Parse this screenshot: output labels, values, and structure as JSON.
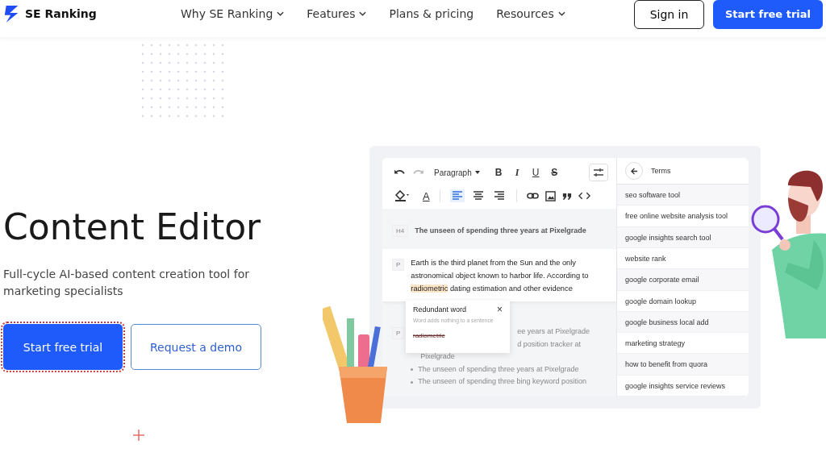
{
  "header": {
    "logo": "SE Ranking",
    "nav": [
      {
        "label": "Why SE Ranking",
        "dropdown": true
      },
      {
        "label": "Features",
        "dropdown": true
      },
      {
        "label": "Plans & pricing",
        "dropdown": false
      },
      {
        "label": "Resources",
        "dropdown": true
      }
    ],
    "sign_in": "Sign in",
    "cta": "Start free trial"
  },
  "hero": {
    "title": "Content Editor",
    "subtitle": "Full-cycle AI-based content creation tool for marketing specialists",
    "buttons": [
      {
        "label": "Start free trial",
        "kind": "primary",
        "focused": true
      },
      {
        "label": "Request a demo",
        "kind": "secondary",
        "focused": false
      }
    ]
  },
  "editor": {
    "block_style": "Paragraph",
    "format": [
      "B",
      "I",
      "U",
      "S"
    ],
    "font_color": "A",
    "alignment": [
      {
        "selected": true
      },
      {
        "selected": false
      },
      {
        "selected": false
      }
    ],
    "heading": {
      "tag": "H4",
      "text": "The unseen of spending three years at Pixelgrade"
    },
    "paragraph": {
      "tag": "P",
      "before": "Earth is the third planet from the Sun and the only astronomical object known to harbor life. According to",
      "highlight": "radiometric",
      "after": "dating estimation and other evidence"
    },
    "popover": {
      "title": "Redundant word",
      "close": "×",
      "subtitle": "Word adds nothing to a sentence",
      "word": "radiometric"
    },
    "second": {
      "tag": "P",
      "lines": [
        {
          "text": "ee years at Pixelgrade",
          "kind": "cut"
        },
        {
          "text": "d position tracker at",
          "kind": "cut"
        },
        {
          "text": "Pixelgrade",
          "kind": "plain"
        },
        {
          "text": "The unseen of spending three years at Pixelgrade",
          "kind": "bullet"
        },
        {
          "text": "The unseen of spending three bing keyword position",
          "kind": "bullet"
        }
      ]
    },
    "terms": {
      "title": "Terms",
      "items": [
        "seo software tool",
        "free online website analysis tool",
        "google insights search tool",
        "website rank",
        "google corporate email",
        "google domain lookup",
        "google business local add",
        "marketing strategy",
        "how to benefit from quora",
        "google insights service reviews"
      ]
    }
  }
}
